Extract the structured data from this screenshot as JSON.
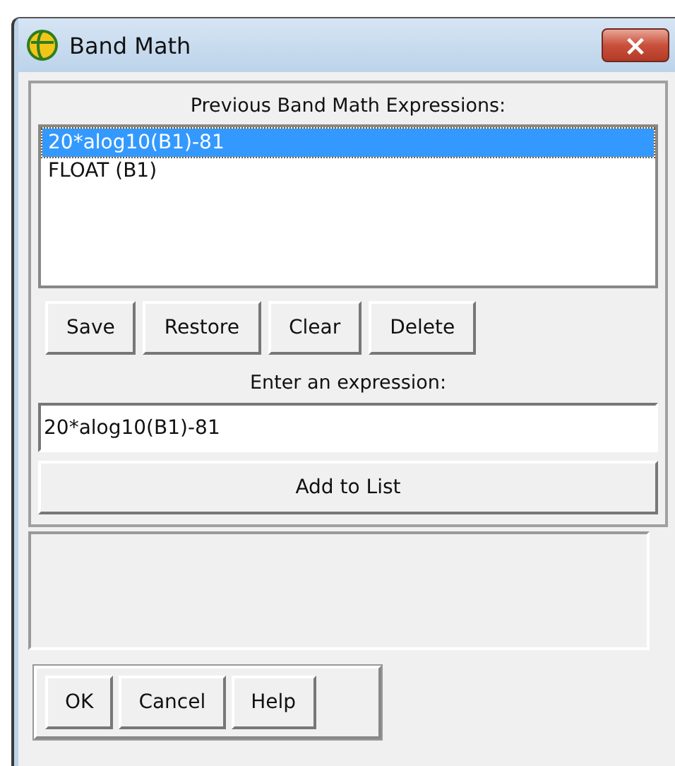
{
  "window": {
    "title": "Band Math",
    "close": "×"
  },
  "history": {
    "label": "Previous Band Math Expressions:",
    "items": [
      {
        "text": "20*alog10(B1)-81",
        "selected": true
      },
      {
        "text": "FLOAT (B1)",
        "selected": false
      }
    ]
  },
  "history_buttons": [
    "Save",
    "Restore",
    "Clear",
    "Delete"
  ],
  "expression": {
    "label": "Enter an expression:",
    "value": "20*alog10(B1)-81"
  },
  "add_button": "Add to List",
  "dialog_buttons": [
    "OK",
    "Cancel",
    "Help"
  ]
}
